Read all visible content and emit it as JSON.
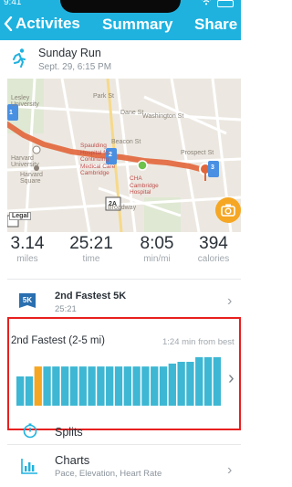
{
  "status_bar": {
    "time": "9:41"
  },
  "header": {
    "back_label": "Activites",
    "title": "Summary",
    "share_label": "Share",
    "color": "#1fb2df"
  },
  "activity": {
    "name": "Sunday Run",
    "date": "Sept. 29, 6:15 PM"
  },
  "map": {
    "labels": {
      "lesley": "Lesley\nUniversity",
      "harvard_univ": "Harvard\nUniversity",
      "harvard_sq": "Harvard\nSquare",
      "spaulding": "Spaulding\nHospital for\nContinuing\nMedical Care\nCambridge",
      "cha": "CHA\nCambridge\nHospital",
      "washington": "Washington St",
      "broadway": "Broadway",
      "beacon": "Beacon St",
      "prospect": "Prospect St",
      "park": "Park St",
      "dane": "Dane St"
    },
    "mile_markers": [
      "1",
      "2",
      "3"
    ],
    "marker_unit": "mi",
    "route_sign": "2A",
    "legal_label": "Legal"
  },
  "stats": [
    {
      "value": "3.14",
      "unit": "miles"
    },
    {
      "value": "25:21",
      "unit": "time"
    },
    {
      "value": "8:05",
      "unit": "min/mi"
    },
    {
      "value": "394",
      "unit": "calories"
    }
  ],
  "achievement": {
    "badge": "5K",
    "title": "2nd Fastest 5K",
    "subtitle": "25:21"
  },
  "highlight": {
    "title": "2nd Fastest (2-5 mi)",
    "delta": "1:24 min from best",
    "bar_color": "#3db7d3",
    "highlight_color": "#f5a623",
    "frame_color": "#e8201f"
  },
  "chart_data": {
    "type": "bar",
    "values": [
      0.5,
      0.5,
      0.67,
      0.67,
      0.67,
      0.67,
      0.67,
      0.67,
      0.67,
      0.67,
      0.67,
      0.67,
      0.67,
      0.67,
      0.67,
      0.67,
      0.67,
      0.72,
      0.75,
      0.75,
      0.83,
      0.83,
      0.83
    ],
    "highlighted_index": 2,
    "ylim": [
      0,
      1
    ]
  },
  "splits": {
    "label": "Splits"
  },
  "charts": {
    "title": "Charts",
    "subtitle": "Pace, Elevation, Heart Rate"
  },
  "icons": {
    "runner": "runner-icon",
    "back": "chevron-left-icon",
    "camera": "camera-icon",
    "stopwatch": "stopwatch-icon",
    "bar_chart": "bar-chart-icon"
  }
}
